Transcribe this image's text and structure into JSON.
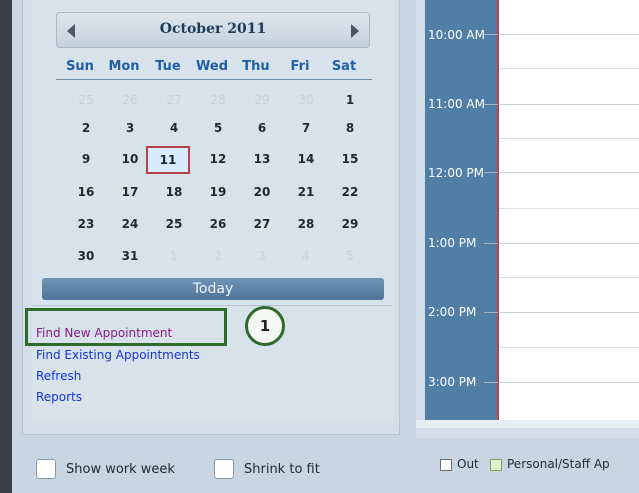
{
  "calendar": {
    "month_title": "October 2011",
    "weekdays": [
      "Sun",
      "Mon",
      "Tue",
      "Wed",
      "Thu",
      "Fri",
      "Sat"
    ],
    "weeks": [
      [
        "25",
        "26",
        "27",
        "28",
        "29",
        "30",
        "1"
      ],
      [
        "2",
        "3",
        "4",
        "5",
        "6",
        "7",
        "8"
      ],
      [
        "9",
        "10",
        "11",
        "12",
        "13",
        "14",
        "15"
      ],
      [
        "16",
        "17",
        "18",
        "19",
        "20",
        "21",
        "22"
      ],
      [
        "23",
        "24",
        "25",
        "26",
        "27",
        "28",
        "29"
      ],
      [
        "30",
        "31",
        "1",
        "2",
        "3",
        "4",
        "5"
      ]
    ],
    "selected_day": "11",
    "today_label": "Today"
  },
  "links": {
    "find_new": "Find New Appointment",
    "find_existing": "Find Existing Appointments",
    "refresh": "Refresh",
    "reports": "Reports"
  },
  "callout": {
    "number": "1"
  },
  "schedule": {
    "times": [
      "10:00 AM",
      "11:00 AM",
      "12:00 PM",
      "1:00 PM",
      "2:00 PM",
      "3:00 PM"
    ]
  },
  "bottom": {
    "show_work_week": "Show work week",
    "shrink_to_fit": "Shrink to fit"
  },
  "legend": {
    "out": "Out",
    "personal": "Personal/Staff Ap"
  },
  "colors": {
    "time_column": "#517ea6",
    "callout_green": "#2e6a2a",
    "selected_border": "#b8434d",
    "link_blue": "#1436d6",
    "link_visited": "#8a1a8a"
  }
}
